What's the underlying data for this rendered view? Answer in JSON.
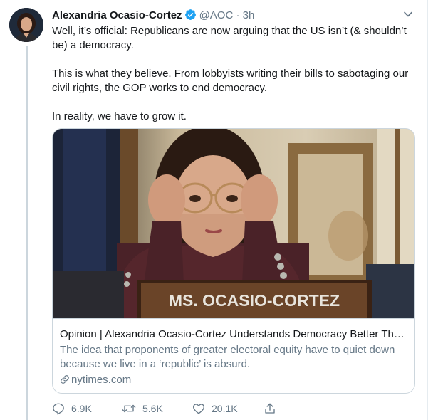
{
  "tweet": {
    "author_name": "Alexandria Ocasio-Cortez",
    "handle": "@AOC",
    "separator": "·",
    "time": "3h",
    "paragraphs": [
      "Well, it’s official: Republicans are now arguing that the US isn’t (& shouldn’t be) a democracy.",
      "This is what they believe. From lobbyists writing their bills to sabotaging our civil rights, the GOP works to end democracy.",
      "In reality, we have to grow it."
    ]
  },
  "card": {
    "image_caption": "MS. OCASIO-CORTEZ",
    "title": "Opinion | Alexandria Ocasio-Cortez Understands Democracy Better Than Her Critics",
    "description": "The idea that proponents of greater electoral equity have to quiet down because we live in a ‘republic’ is absurd.",
    "domain": "nytimes.com"
  },
  "actions": {
    "replies": "6.9K",
    "retweets": "5.6K",
    "likes": "20.1K"
  },
  "colors": {
    "primary_text": "#14171a",
    "secondary_text": "#657786",
    "verified_blue": "#1da1f2",
    "border": "#ccd6dd"
  },
  "icons": [
    "verified-badge-icon",
    "chevron-down-icon",
    "link-icon",
    "reply-icon",
    "retweet-icon",
    "like-icon",
    "share-icon"
  ]
}
